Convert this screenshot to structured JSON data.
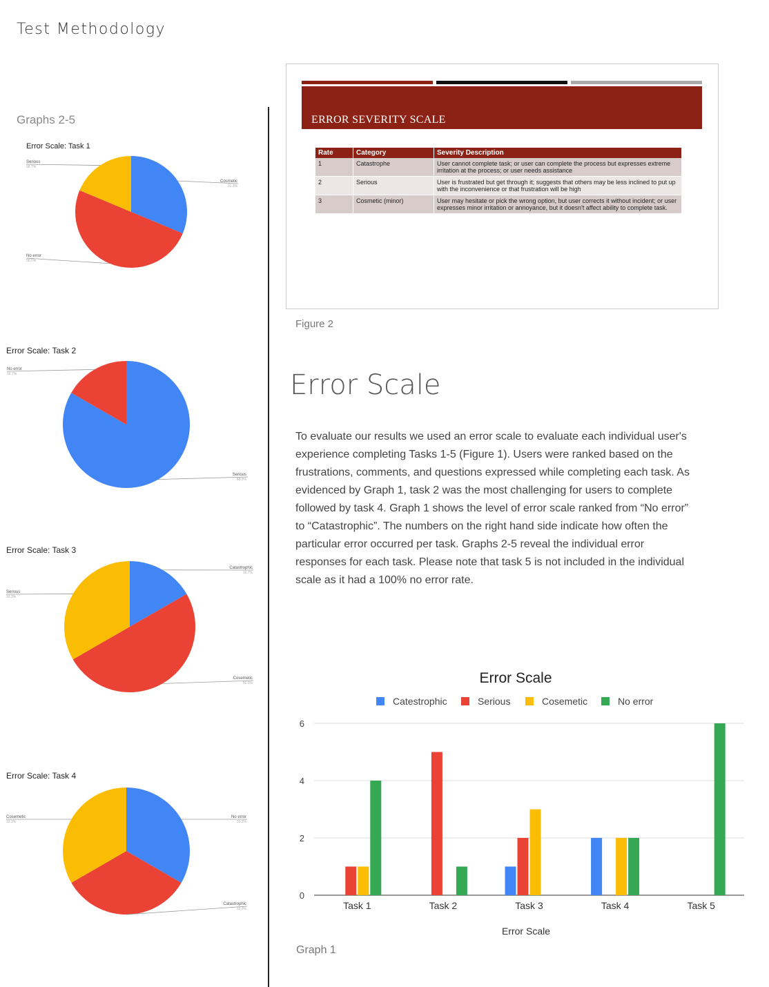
{
  "page": {
    "title": "Test Methodology",
    "graphs_heading": "Graphs 2-5",
    "figure_caption": "Figure 2",
    "section_heading": "Error Scale",
    "body_text": "To evaluate our results we used an error scale to evaluate each individual user's experience completing Tasks 1-5 (Figure 1). Users were ranked based on the frustrations, comments, and questions expressed while completing each task. As evidenced by Graph 1, task 2 was the most challenging for users to complete followed by task 4. Graph 1 shows the level of error scale ranked from “No error” to “Catastrophic”. The numbers on the right hand side indicate how often the particular error occurred per task. Graphs 2-5 reveal the individual error responses for each task. Please note that task 5 is not included in the individual scale as it had a 100% no error rate.",
    "graph_caption": "Graph 1"
  },
  "colors": {
    "catastrophic": "#4285f4",
    "serious": "#ea4335",
    "cosmetic": "#fbbc04",
    "no_error": "#34a853",
    "slide_red": "#8b2215"
  },
  "slide": {
    "title": "ERROR SEVERITY SCALE",
    "columns": [
      "Rate",
      "Category",
      "Severity Description"
    ],
    "rows": [
      {
        "rate": "1",
        "category": "Catastrophe",
        "description": "User cannot complete task; or user can complete the process but expresses extreme irritation at the process; or user needs assistance"
      },
      {
        "rate": "2",
        "category": "Serious",
        "description": "User is frustrated but get through it; suggests that others may be less inclined to put up with the inconvenience or that frustration will be high"
      },
      {
        "rate": "3",
        "category": "Cosmetic (minor)",
        "description": "User may hesitate or pick the wrong option, but user corrects it without incident; or user expresses minor irritation or annoyance, but it doesn't affect ability to complete task."
      }
    ]
  },
  "chart_data": [
    {
      "type": "bar",
      "title": "Error Scale",
      "xlabel": "Error Scale",
      "ylabel": "",
      "categories": [
        "Task 1",
        "Task 2",
        "Task 3",
        "Task 4",
        "Task 5"
      ],
      "ylim": [
        0,
        6
      ],
      "yticks": [
        0,
        2,
        4,
        6
      ],
      "grid": true,
      "legend_position": "top",
      "series": [
        {
          "name": "Catestrophic",
          "color": "#4285f4",
          "values": [
            0,
            0,
            1,
            2,
            0
          ]
        },
        {
          "name": "Serious",
          "color": "#ea4335",
          "values": [
            1,
            5,
            2,
            0,
            0
          ]
        },
        {
          "name": "Cosemetic",
          "color": "#fbbc04",
          "values": [
            1,
            0,
            3,
            2,
            0
          ]
        },
        {
          "name": "No error",
          "color": "#34a853",
          "values": [
            4,
            1,
            0,
            2,
            6
          ]
        }
      ]
    },
    {
      "type": "pie",
      "title": "Error Scale: Task 1",
      "slices": [
        {
          "label": "Cosmetic",
          "value": 31.3,
          "pct": "31.3%",
          "color": "#4285f4"
        },
        {
          "label": "No error",
          "value": 50.0,
          "pct": "50.0%",
          "color": "#ea4335"
        },
        {
          "label": "Serious",
          "value": 18.7,
          "pct": "18.7%",
          "color": "#fbbc04"
        }
      ]
    },
    {
      "type": "pie",
      "title": "Error Scale: Task 2",
      "slices": [
        {
          "label": "Serious",
          "value": 83.3,
          "pct": "83.3%",
          "color": "#4285f4"
        },
        {
          "label": "No error",
          "value": 16.7,
          "pct": "16.7%",
          "color": "#ea4335"
        }
      ]
    },
    {
      "type": "pie",
      "title": "Error Scale: Task 3",
      "slices": [
        {
          "label": "Catastrophic",
          "value": 16.7,
          "pct": "16.7%",
          "color": "#4285f4"
        },
        {
          "label": "Cosemetic",
          "value": 50.0,
          "pct": "50.0%",
          "color": "#ea4335"
        },
        {
          "label": "Serious",
          "value": 33.3,
          "pct": "33.3%",
          "color": "#fbbc04"
        }
      ]
    },
    {
      "type": "pie",
      "title": "Error Scale: Task 4",
      "slices": [
        {
          "label": "No error",
          "value": 33.3,
          "pct": "33.3%",
          "color": "#4285f4"
        },
        {
          "label": "Catastrophic",
          "value": 33.3,
          "pct": "33.3%",
          "color": "#ea4335"
        },
        {
          "label": "Cosemetic",
          "value": 33.3,
          "pct": "33.3%",
          "color": "#fbbc04"
        }
      ]
    }
  ]
}
